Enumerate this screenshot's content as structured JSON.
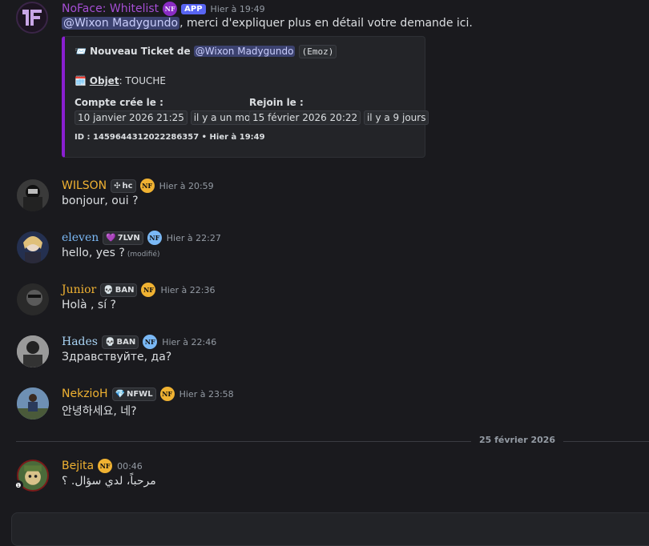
{
  "messages": [
    {
      "author": "NoFace: Whitelist",
      "author_color": "#a54ed4",
      "badge": "APP",
      "time": "Hier à 19:49",
      "mention": "@Wixon Madygundo",
      "text": ", merci d'expliquer plus en détail votre demande ici.",
      "embed": {
        "title_emoji": "📨",
        "title": "Nouveau Ticket de",
        "title_mention": "@Wixon Madygundo",
        "title_code": "(Emoz)",
        "subject_emoji": "🗓️",
        "subject_label": "Objet",
        "subject_value": ": TOUCHE",
        "created_label": "Compte crée le :",
        "created_date": "10 janvier 2026 21:25",
        "created_rel": "il y a un mois",
        "joined_label": "Rejoin le :",
        "joined_date": "15 février 2026 20:22",
        "joined_rel": "il y a 9 jours",
        "footer": "ID : 1459644312022286357 • Hier à 19:49"
      }
    },
    {
      "author": "WILSON",
      "author_color": "#f0b232",
      "tag": "hc",
      "tag_icon": "✣",
      "guild": "NF",
      "guild_color": "gold",
      "time": "Hier à 20:59",
      "text": "bonjour, oui ?"
    },
    {
      "author": "eleven",
      "author_color": "#7ab8f5",
      "tag": "7LVN",
      "tag_icon": "💜",
      "guild": "NF",
      "guild_color": "blue",
      "time": "Hier à 22:27",
      "text": "hello, yes ?",
      "edited": "(modifié)"
    },
    {
      "author": "Junior",
      "author_color": "#f0b232",
      "tag": "BAN",
      "tag_icon": "💀",
      "guild": "NF",
      "guild_color": "gold",
      "time": "Hier à 22:36",
      "text": "Holà ,  sí ?"
    },
    {
      "author": "Hades",
      "author_color": "#a9d4f5",
      "tag": "BAN",
      "tag_icon": "💀",
      "guild": "NF",
      "guild_color": "blue",
      "time": "Hier à 22:46",
      "text": "Здравствуйте, да?"
    },
    {
      "author": "NekzioH",
      "author_color": "#f0b232",
      "tag": "NFWL",
      "tag_icon": "💎",
      "guild": "NF",
      "guild_color": "gold",
      "time": "Hier à 23:58",
      "text": "안녕하세요, 네?"
    },
    {
      "author": "Bejita",
      "author_color": "#f0b232",
      "guild": "NF",
      "guild_color": "gold",
      "time": "00:46",
      "text": "مرحباً، لدي سؤال. ؟"
    }
  ],
  "divider_date": "25 février 2026"
}
